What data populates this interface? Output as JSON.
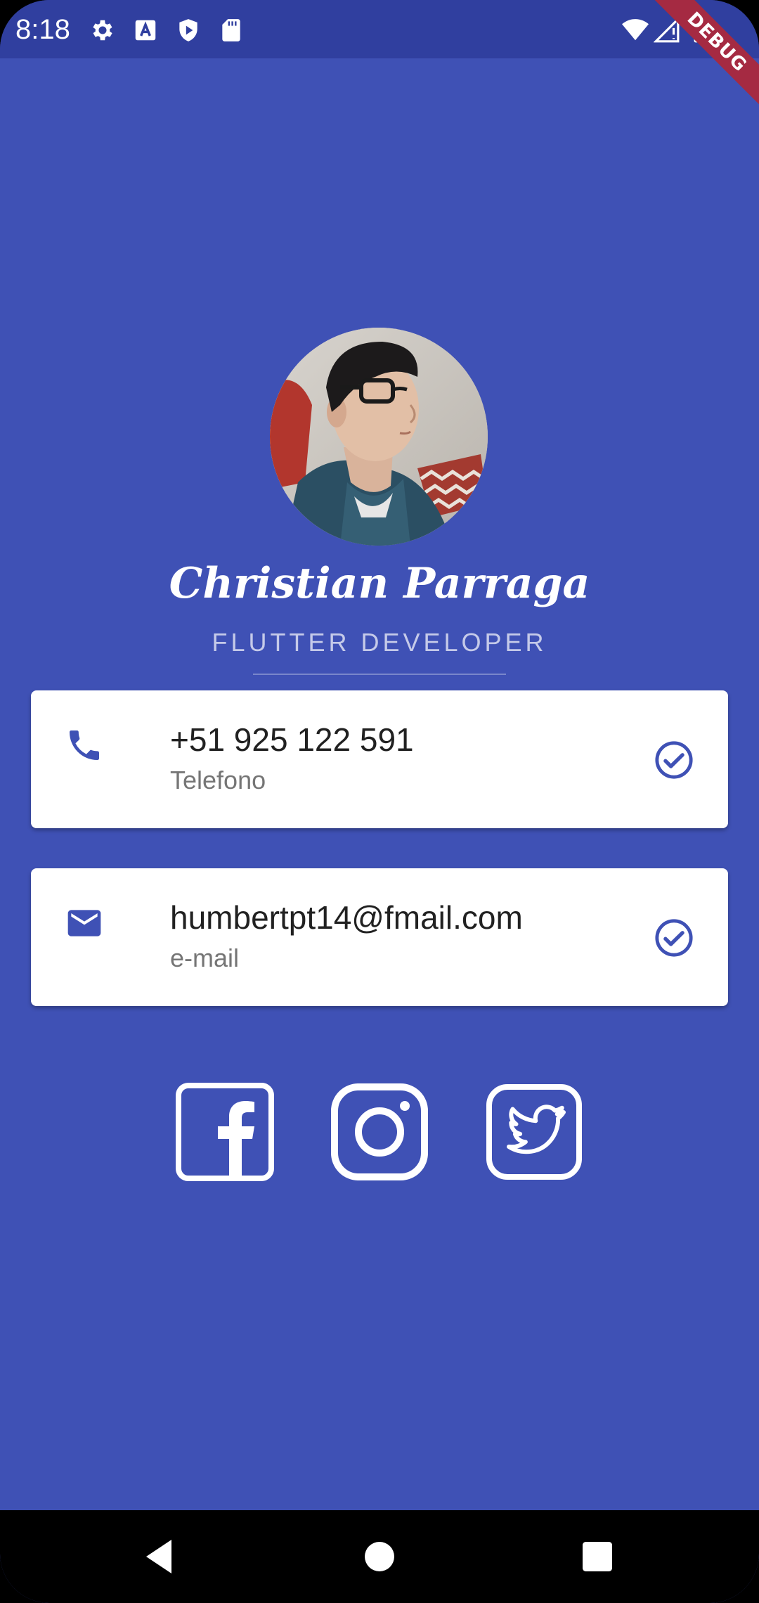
{
  "status_bar": {
    "time": "8:18",
    "icons": [
      "settings-icon",
      "a-icon",
      "shield-play-icon",
      "sd-card-icon",
      "wifi-icon",
      "signal-icon",
      "battery-icon"
    ],
    "debug_label": "DEBUG"
  },
  "profile": {
    "name": "Christian Parraga",
    "role": "FLUTTER DEVELOPER",
    "avatar": "profile-photo"
  },
  "contacts": [
    {
      "icon": "phone-icon",
      "value": "+51 925 122 591",
      "label": "Telefono",
      "trailing": "check-circle-icon"
    },
    {
      "icon": "mail-icon",
      "value": "humbertpt14@fmail.com",
      "label": "e-mail",
      "trailing": "check-circle-icon"
    }
  ],
  "social": [
    "facebook-icon",
    "instagram-icon",
    "twitter-icon"
  ],
  "colors": {
    "background": "#3F51B5",
    "status_bar": "#303F9F",
    "accent": "#3F51B5",
    "card": "#FFFFFF",
    "role_text": "#C5CAE9"
  },
  "nav_bar": [
    "back-button",
    "home-button",
    "recents-button"
  ]
}
